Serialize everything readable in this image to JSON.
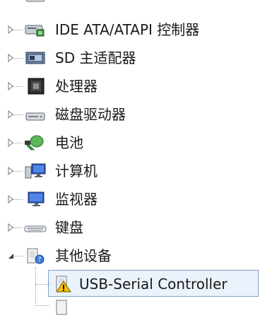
{
  "tree": {
    "items": [
      {
        "label": "IDE ATA/ATAPI 控制器",
        "icon": "ide-controller-icon",
        "expanded": false
      },
      {
        "label": "SD 主适配器",
        "icon": "sd-host-adapter-icon",
        "expanded": false
      },
      {
        "label": "处理器",
        "icon": "processor-chip-icon",
        "expanded": false
      },
      {
        "label": "磁盘驱动器",
        "icon": "disk-drive-icon",
        "expanded": false
      },
      {
        "label": "电池",
        "icon": "battery-icon",
        "expanded": false
      },
      {
        "label": "计算机",
        "icon": "computer-icon",
        "expanded": false
      },
      {
        "label": "监视器",
        "icon": "monitor-icon",
        "expanded": false
      },
      {
        "label": "键盘",
        "icon": "keyboard-icon",
        "expanded": false
      },
      {
        "label": "其他设备",
        "icon": "unknown-device-icon",
        "expanded": true
      }
    ],
    "children": [
      {
        "label": "USB-Serial Controller",
        "icon": "warning-device-icon",
        "selected": true
      }
    ]
  },
  "colors": {
    "selection_border": "#7da2ce",
    "selection_fill": "#eaf2fb",
    "warning": "#f2c200",
    "expander": "#7a7a7a"
  }
}
